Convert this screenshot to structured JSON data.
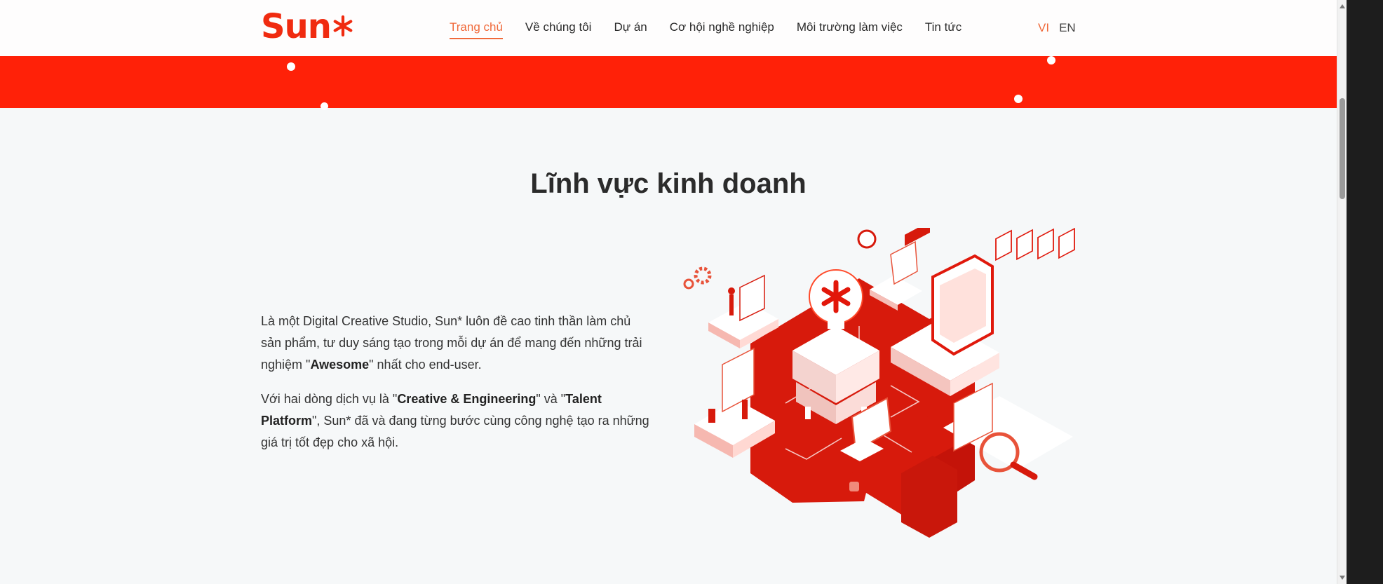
{
  "header": {
    "logo_text": "Sun",
    "logo_star": "*",
    "nav": [
      {
        "label": "Trang chủ",
        "active": true
      },
      {
        "label": "Về chúng tôi",
        "active": false
      },
      {
        "label": "Dự án",
        "active": false
      },
      {
        "label": "Cơ hội nghề nghiệp",
        "active": false
      },
      {
        "label": "Môi trường làm việc",
        "active": false
      },
      {
        "label": "Tin tức",
        "active": false
      }
    ],
    "languages": [
      {
        "label": "VI",
        "selected": true
      },
      {
        "label": "EN",
        "selected": false
      }
    ]
  },
  "section": {
    "title": "Lĩnh vực kinh doanh",
    "para1": {
      "before": "Là một Digital Creative Studio, Sun* luôn đề cao tinh thần làm chủ sản phẩm, tư duy sáng tạo trong mỗi dự án để mang đến những trải nghiệm \"",
      "bold": "Awesome",
      "after": "\" nhất cho end-user."
    },
    "para2": {
      "before": "Với hai dòng dịch vụ là \"",
      "bold1": "Creative & Engineering",
      "middle": "\" và \"",
      "bold2": "Talent Platform",
      "after": "\", Sun* đã và đang từng bước cùng công nghệ tạo ra những giá trị tốt đẹp cho xã hội."
    }
  },
  "colors": {
    "brand_red": "#ff2108",
    "accent_orange": "#f06a3b",
    "illustration_red": "#d71a0c",
    "background": "#f6f8f9"
  }
}
